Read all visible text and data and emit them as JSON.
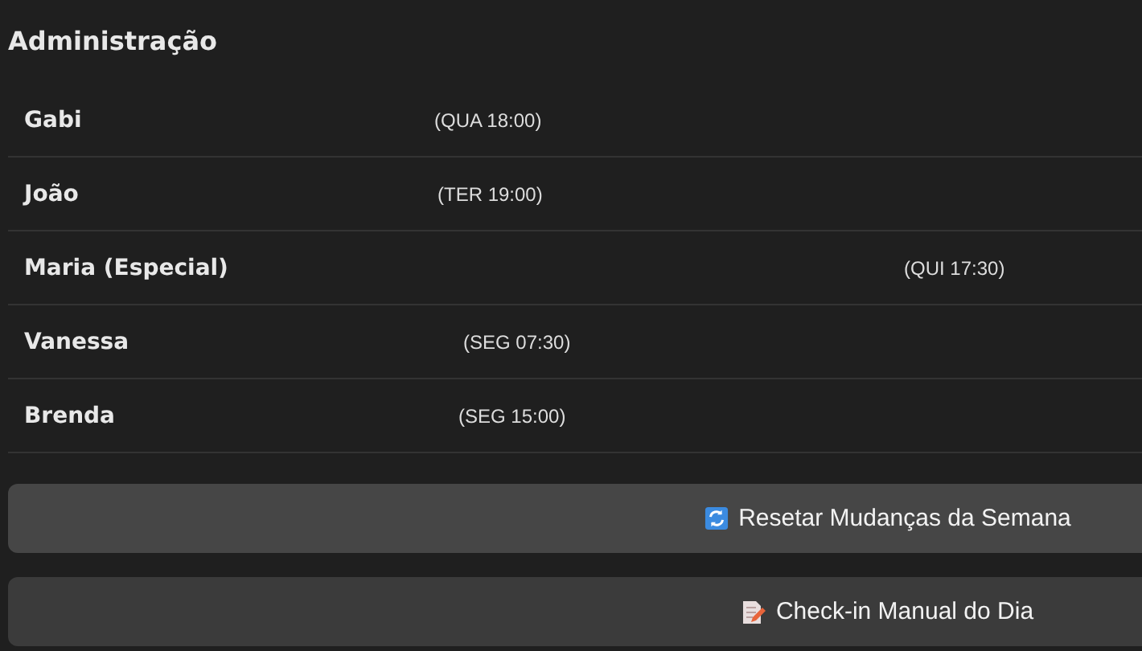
{
  "title": "Administração",
  "people": [
    {
      "name": "Gabi",
      "time": "(QUA 18:00)"
    },
    {
      "name": "João",
      "time": "(TER 19:00)"
    },
    {
      "name": "Maria (Especial)",
      "time": "(QUI 17:30)"
    },
    {
      "name": "Vanessa",
      "time": "(SEG 07:30)"
    },
    {
      "name": "Brenda",
      "time": "(SEG 15:00)"
    }
  ],
  "buttons": [
    {
      "kind": "reset",
      "label": "Resetar Mudanças da Semana"
    },
    {
      "kind": "checkin",
      "label": "Check-in Manual do Dia"
    }
  ]
}
